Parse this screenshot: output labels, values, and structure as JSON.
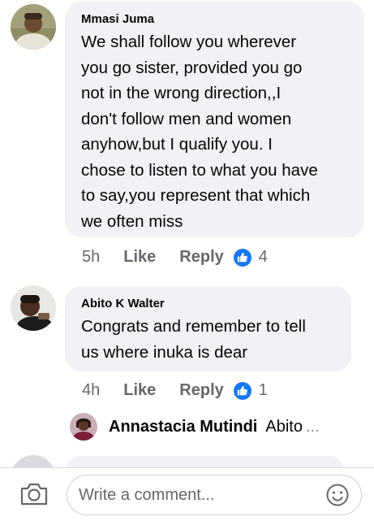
{
  "comments": [
    {
      "author": "Mmasi Juma",
      "lines": [
        "We shall follow you wherever",
        "you go sister, provided you go",
        "not in the wrong direction,,I",
        "don't follow men and women",
        "anyhow,but I qualify you. I",
        "chose to listen to what you have",
        "to say,you represent that which",
        "we often miss"
      ],
      "time": "5h",
      "like_label": "Like",
      "reply_label": "Reply",
      "reaction_count": "4"
    },
    {
      "author": "Abito K Walter",
      "lines": [
        "Congrats and remember to tell",
        "us where inuka is dear"
      ],
      "time": "4h",
      "like_label": "Like",
      "reply_label": "Reply",
      "reaction_count": "1"
    }
  ],
  "reply_preview": {
    "author": "Annastacia Mutindi",
    "text": "Abito",
    "ellipsis": "..."
  },
  "composer": {
    "placeholder": "Write a comment...",
    "camera_icon": "camera-icon",
    "emoji_icon": "smiley-emoji-icon"
  },
  "colors": {
    "bubble": "#f0f2f5",
    "secondary_text": "#65676b",
    "like_blue": "#1877f2"
  }
}
